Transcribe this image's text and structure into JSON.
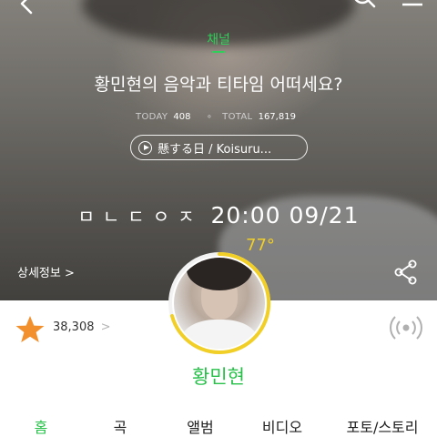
{
  "header": {
    "channel_label": "채널",
    "title": "황민현의 음악과 티타임 어떠세요?",
    "today_label": "TODAY",
    "today_value": "408",
    "total_label": "TOTAL",
    "total_value": "167,819",
    "separator": "∘",
    "now_playing": "懸する日 / Koisuru..."
  },
  "countdown": {
    "jamo": "ㅁㄴㄷㅇㅈ",
    "time": "20:00 09/21"
  },
  "temperature": "77°",
  "detail_link": "상세정보 >",
  "likes": {
    "count": "38,308",
    "chevron": ">"
  },
  "artist": {
    "name": "황민현"
  },
  "tabs": [
    {
      "label": "홈",
      "active": true
    },
    {
      "label": "곡",
      "active": false
    },
    {
      "label": "앨범",
      "active": false
    },
    {
      "label": "비디오",
      "active": false
    },
    {
      "label": "포토/스토리",
      "active": false
    }
  ],
  "colors": {
    "accent_green": "#27c149",
    "star_orange": "#f2902e",
    "ring_yellow": "#f1cf26"
  },
  "icons": [
    "back-icon",
    "search-icon",
    "menu-icon",
    "play-icon",
    "share-icon",
    "star-icon",
    "radio-icon"
  ]
}
